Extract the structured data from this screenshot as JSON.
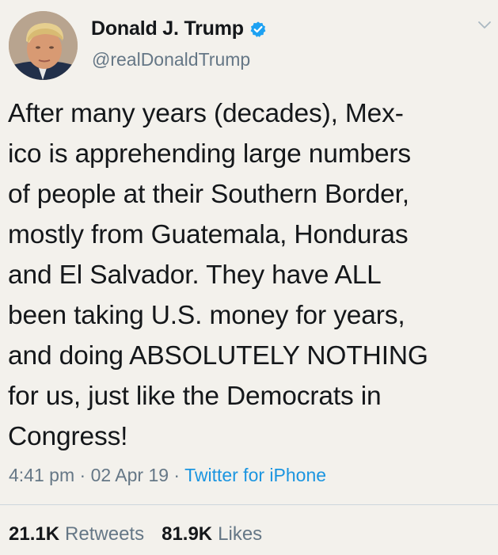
{
  "author": {
    "display_name": "Donald J. Trump",
    "handle": "@realDonaldTrump",
    "verified": true,
    "avatar_icon": "profile-photo",
    "verified_icon": "verified-badge-icon"
  },
  "menu_icon": "chevron-down-icon",
  "tweet": {
    "text": "After many years (decades), Mex-\nico is apprehending large numbers\nof people at their Southern Border,\nmostly from Guatemala, Honduras\nand El Salvador. They have ALL\nbeen taking U.S. money for years,\nand doing ABSOLUTELY NOTHING\nfor us, just like the Democrats in\nCongress!"
  },
  "meta": {
    "time": "4:41 pm",
    "separator": " · ",
    "date": "02 Apr 19",
    "source": "Twitter for iPhone"
  },
  "stats": {
    "retweets_count": "21.1K",
    "retweets_label": "Retweets",
    "likes_count": "81.9K",
    "likes_label": "Likes"
  },
  "colors": {
    "background": "#f3f1ec",
    "text": "#14171a",
    "secondary": "#657786",
    "link": "#1b95e0",
    "verified": "#1da1f2"
  }
}
